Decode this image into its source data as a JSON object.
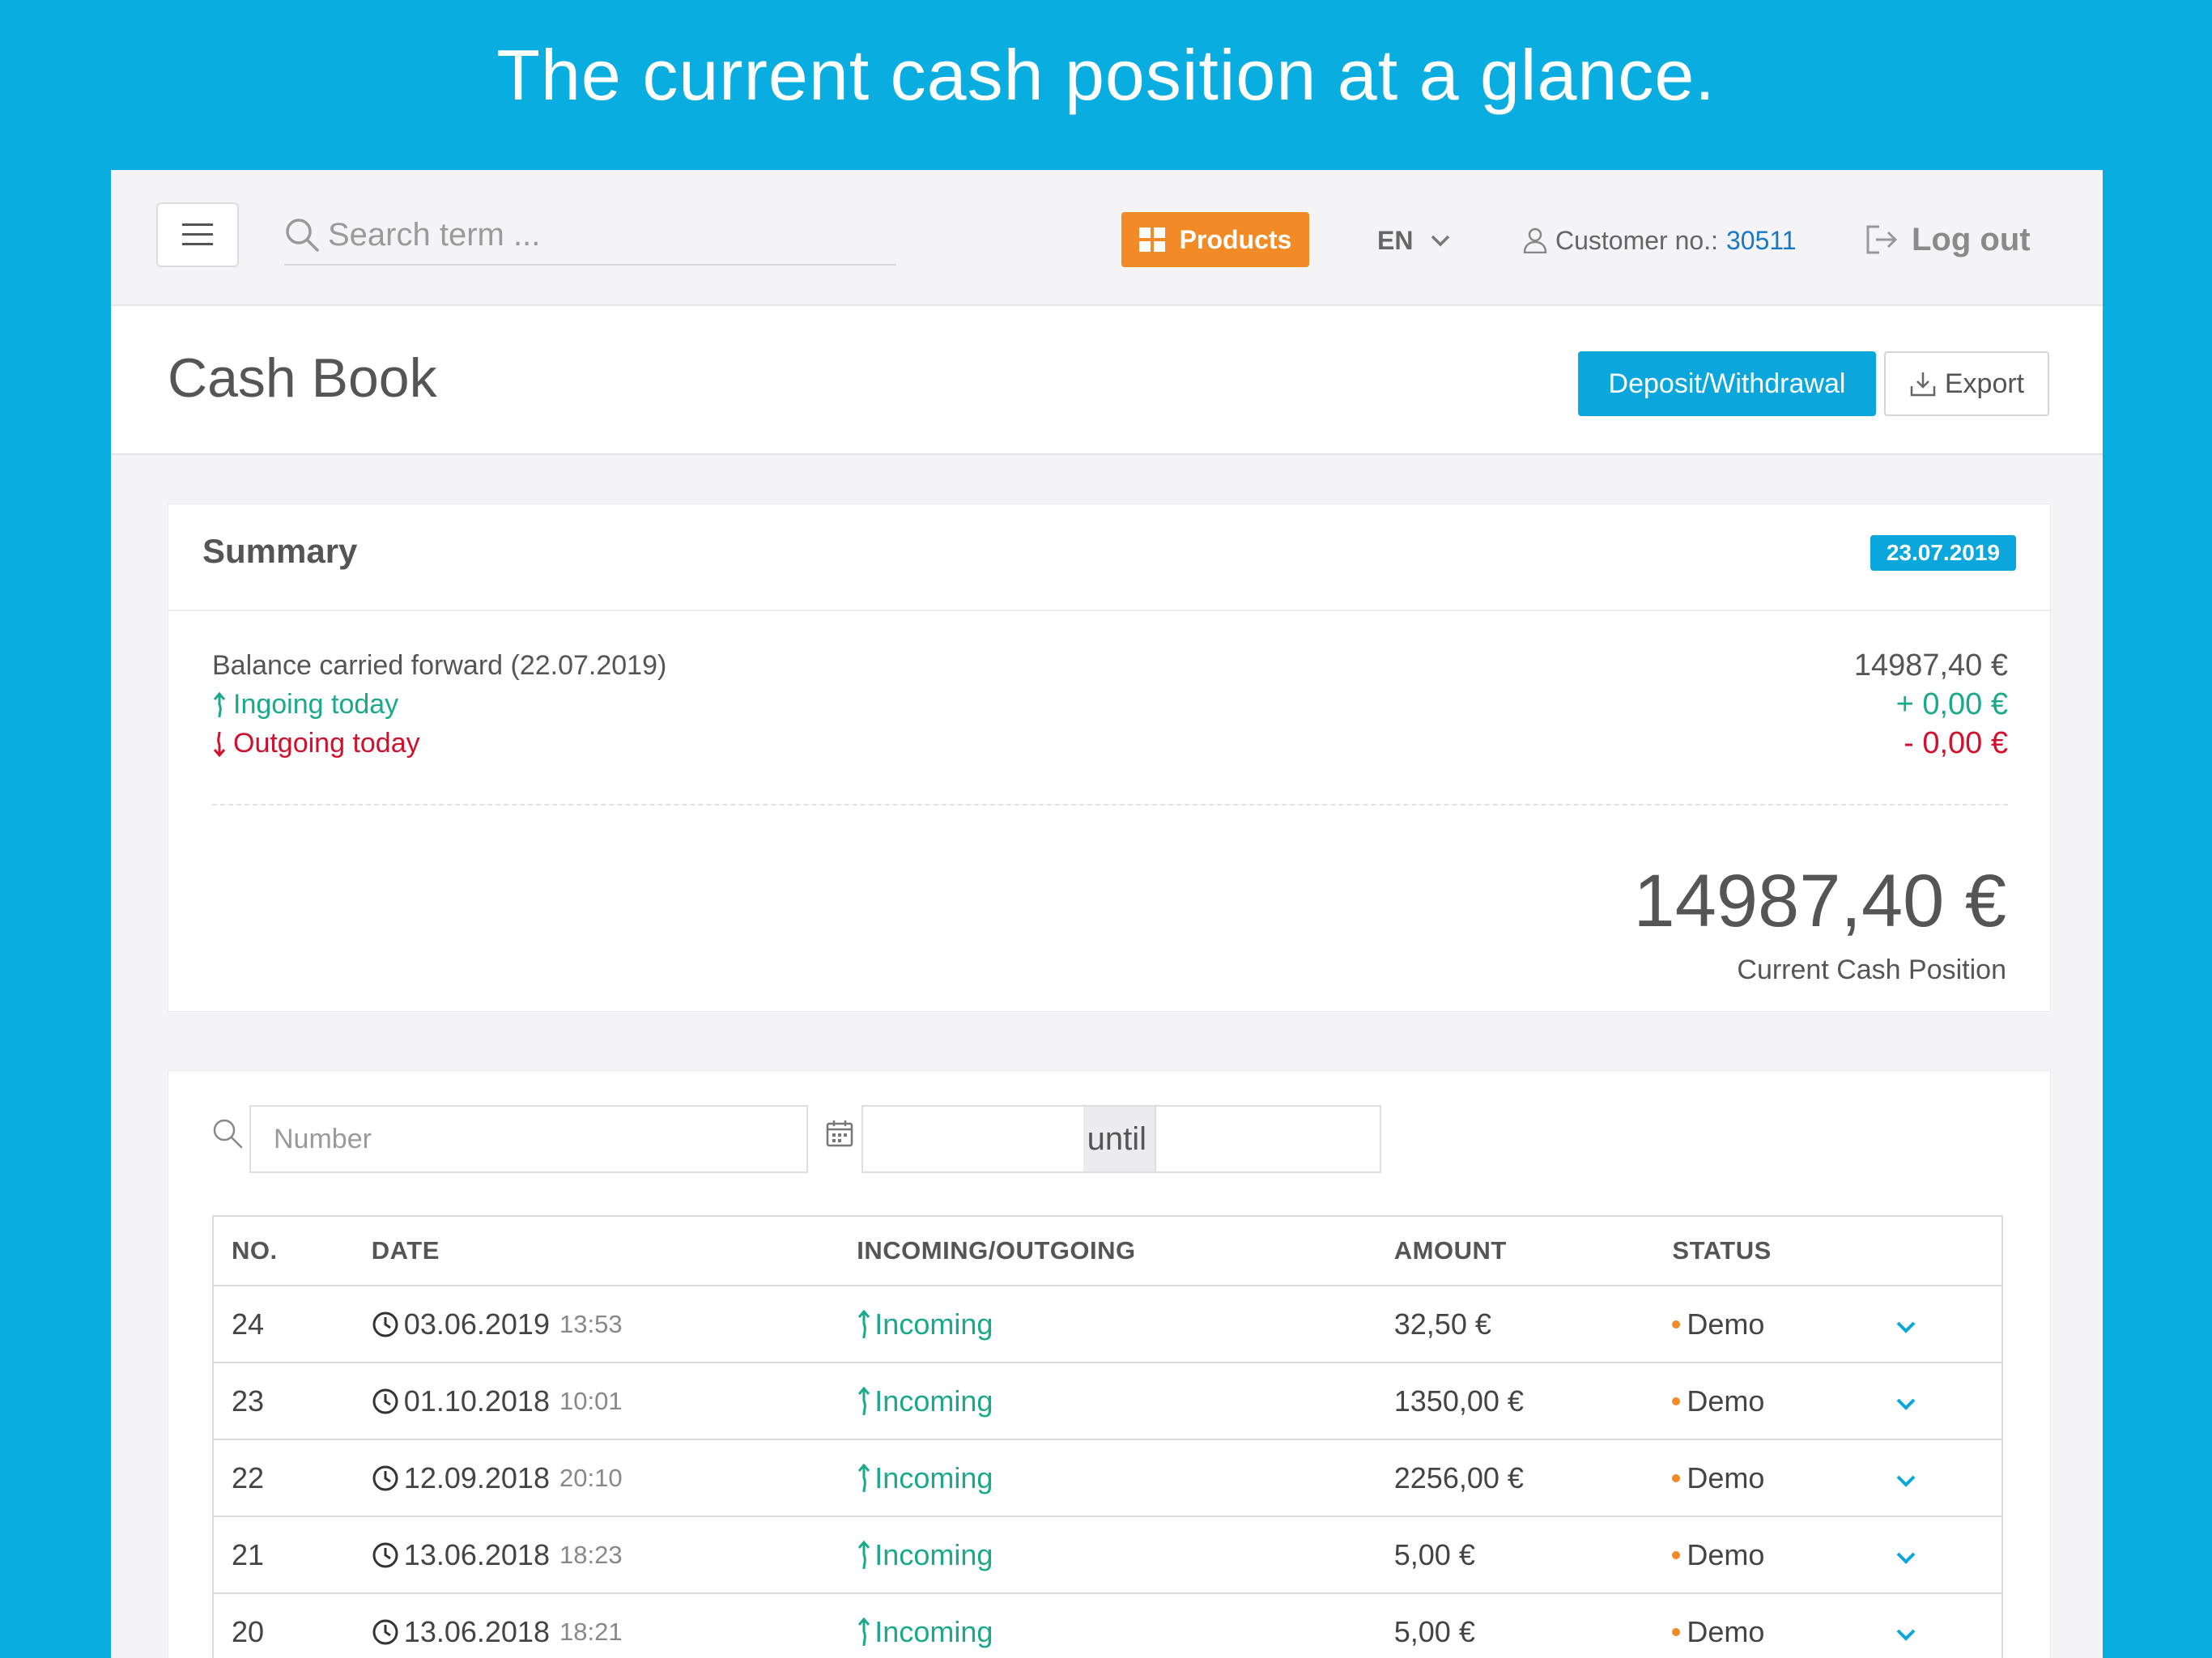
{
  "promo": {
    "headline": "The current cash position at a glance."
  },
  "topbar": {
    "search_placeholder": "Search term ...",
    "products_label": "Products",
    "language": "EN",
    "customer_label": "Customer no.:",
    "customer_number": "30511",
    "logout_label": "Log out"
  },
  "page": {
    "title": "Cash Book",
    "deposit_label": "Deposit/Withdrawal",
    "export_label": "Export"
  },
  "summary": {
    "title": "Summary",
    "date": "23.07.2019",
    "balance_label": "Balance carried forward (22.07.2019)",
    "balance_value": "14987,40 €",
    "ingoing_label": "Ingoing today",
    "ingoing_value": "+ 0,00 €",
    "outgoing_label": "Outgoing today",
    "outgoing_value": "- 0,00 €",
    "cash_position_value": "14987,40 €",
    "cash_position_label": "Current Cash Position"
  },
  "filters": {
    "number_placeholder": "Number",
    "until_label": "until"
  },
  "table": {
    "headers": [
      "NO.",
      "DATE",
      "INCOMING/OUTGOING",
      "AMOUNT",
      "STATUS"
    ],
    "rows": [
      {
        "no": "24",
        "date": "03.06.2019",
        "time": "13:53",
        "direction": "Incoming",
        "amount": "32,50 €",
        "status": "Demo"
      },
      {
        "no": "23",
        "date": "01.10.2018",
        "time": "10:01",
        "direction": "Incoming",
        "amount": "1350,00 €",
        "status": "Demo"
      },
      {
        "no": "22",
        "date": "12.09.2018",
        "time": "20:10",
        "direction": "Incoming",
        "amount": "2256,00 €",
        "status": "Demo"
      },
      {
        "no": "21",
        "date": "13.06.2018",
        "time": "18:23",
        "direction": "Incoming",
        "amount": "5,00 €",
        "status": "Demo"
      },
      {
        "no": "20",
        "date": "13.06.2018",
        "time": "18:21",
        "direction": "Incoming",
        "amount": "5,00 €",
        "status": "Demo"
      }
    ]
  },
  "colors": {
    "background": "#0aade0",
    "accent_blue": "#0aa6dc",
    "products_orange": "#f28a25",
    "incoming_green": "#1aa98b",
    "outgoing_red": "#d0102c",
    "link_blue": "#1778c6"
  },
  "icons": {
    "menu": "hamburger-icon",
    "search": "search-icon",
    "products": "grid-icon",
    "language": "chevron-down-icon",
    "customer": "user-icon",
    "logout": "logout-icon",
    "export": "download-icon",
    "calendar": "calendar-icon",
    "time": "clock-icon",
    "incoming": "arrow-up-icon",
    "outgoing": "arrow-down-icon",
    "expand": "chevron-down-icon"
  }
}
